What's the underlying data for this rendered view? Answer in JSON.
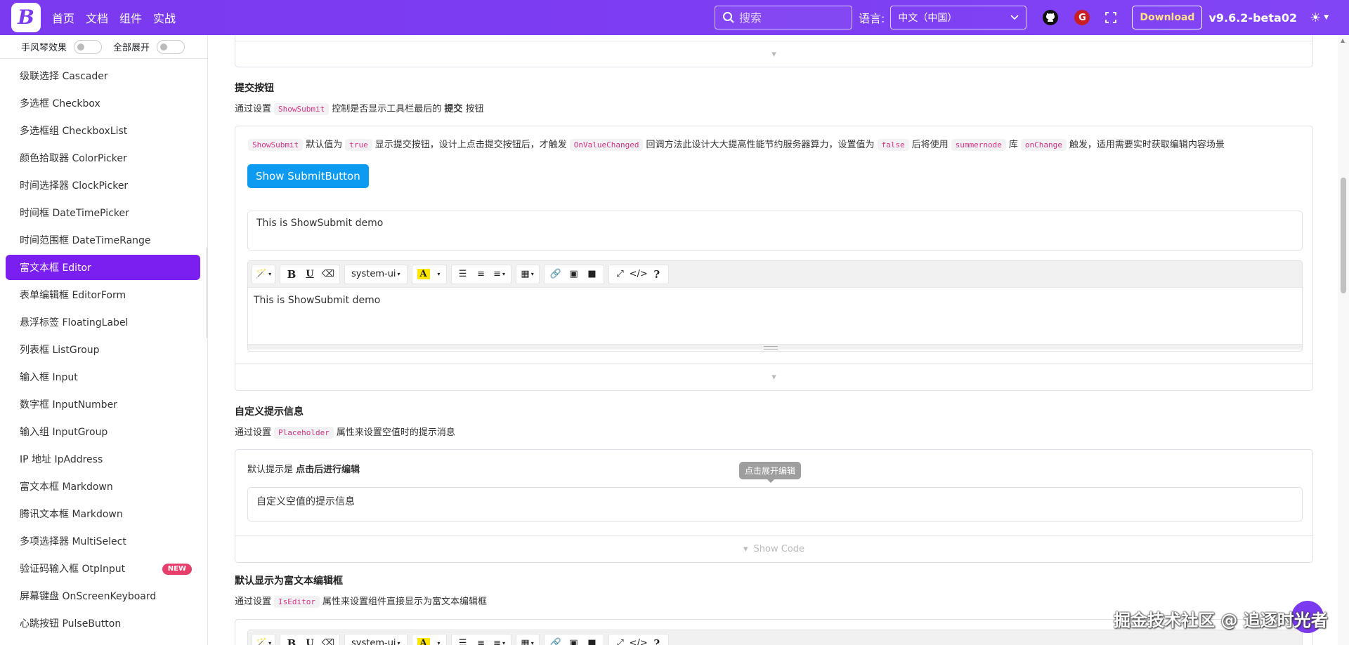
{
  "navbar": {
    "logo": "B",
    "links": [
      "首页",
      "文档",
      "组件",
      "实战"
    ],
    "search_placeholder": "搜索",
    "lang_label": "语言:",
    "lang_value": "中文（中国）",
    "gitee_letter": "G",
    "download": "Download",
    "version": "v9.6.2-beta02",
    "theme_icon": "☀"
  },
  "sidebar": {
    "accordion_label": "手风琴效果",
    "expand_label": "全部展开",
    "items": [
      "级联选择 Cascader",
      "多选框 Checkbox",
      "多选框组 CheckboxList",
      "颜色拾取器 ColorPicker",
      "时间选择器 ClockPicker",
      "时间框 DateTimePicker",
      "时间范围框 DateTimeRange",
      "富文本框 Editor",
      "表单编辑框 EditorForm",
      "悬浮标签 FloatingLabel",
      "列表框 ListGroup",
      "输入框 Input",
      "数字框 InputNumber",
      "输入组 InputGroup",
      "IP 地址 IpAddress",
      "富文本框 Markdown",
      "腾讯文本框 Markdown",
      "多项选择器 MultiSelect",
      "验证码输入框 OtpInput",
      "屏幕键盘 OnScreenKeyboard",
      "心跳按钮 PulseButton"
    ],
    "new_badge": "NEW"
  },
  "submit_section": {
    "title": "提交按钮",
    "desc_prefix": "通过设置",
    "desc_code": "ShowSubmit",
    "desc_mid": "控制是否显示工具栏最后的",
    "desc_bold": "提交",
    "desc_suffix": "按钮",
    "info": {
      "c1": "ShowSubmit",
      "t1": "默认值为",
      "c2": "true",
      "t2": "显示提交按钮，设计上点击提交按钮后，才触发",
      "c3": "OnValueChanged",
      "t3": "回调方法此设计大大提高性能节约服务器算力，设置值为",
      "c4": "false",
      "t4": "后将使用",
      "c5": "summernode",
      "t5": "库",
      "c6": "onChange",
      "t6": "触发，适用需要实时获取编辑内容场景"
    },
    "button": "Show SubmitButton",
    "textarea_value": "This is ShowSubmit demo",
    "editor_content": "This is ShowSubmit demo"
  },
  "toolbar": {
    "font": "system-ui",
    "highlight": "A",
    "help": "?"
  },
  "placeholder_section": {
    "title": "自定义提示信息",
    "desc_prefix": "通过设置",
    "desc_code": "Placeholder",
    "desc_suffix": "属性来设置空值时的提示消息",
    "info_prefix": "默认提示是",
    "info_bold": "点击后进行编辑",
    "tooltip": "点击展开编辑",
    "input_value": "自定义空值的提示信息",
    "show_code": "Show Code"
  },
  "iseditor_section": {
    "title": "默认显示为富文本编辑框",
    "desc_prefix": "通过设置",
    "desc_code": "IsEditor",
    "desc_suffix": "属性来设置组件直接显示为富文本编辑框"
  },
  "watermark": "掘金技术社区 @ 追逐时光者"
}
